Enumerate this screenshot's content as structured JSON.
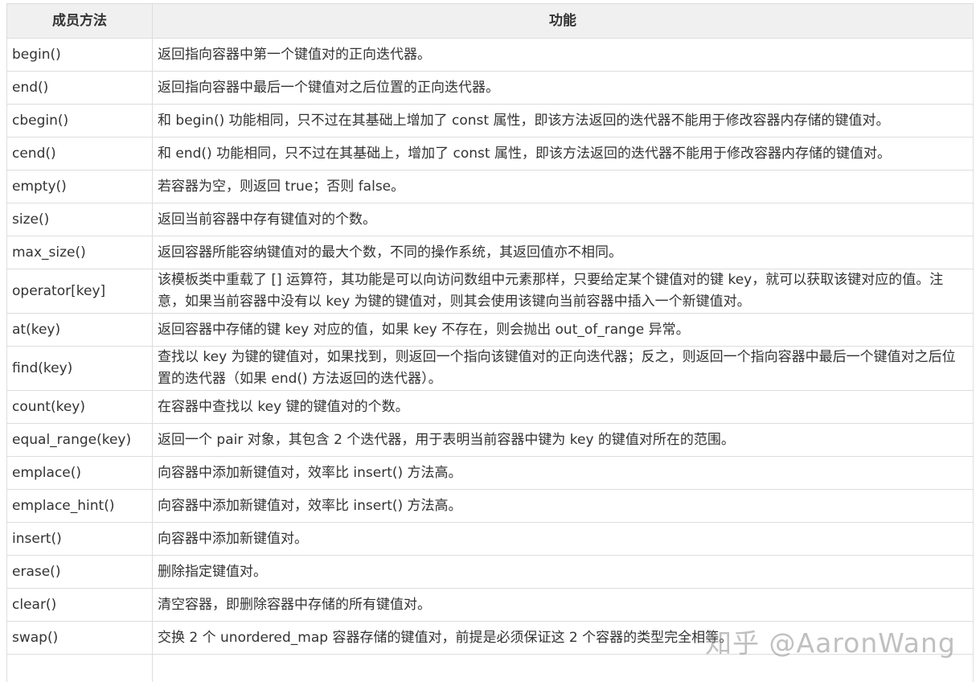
{
  "table": {
    "headers": [
      "成员方法",
      "功能"
    ],
    "rows": [
      {
        "method": "begin()",
        "desc": "返回指向容器中第一个键值对的正向迭代器。"
      },
      {
        "method": "end()",
        "desc": "返回指向容器中最后一个键值对之后位置的正向迭代器。"
      },
      {
        "method": "cbegin()",
        "desc": "和 begin() 功能相同，只不过在其基础上增加了 const 属性，即该方法返回的迭代器不能用于修改容器内存储的键值对。"
      },
      {
        "method": "cend()",
        "desc": "和 end() 功能相同，只不过在其基础上，增加了 const 属性，即该方法返回的迭代器不能用于修改容器内存储的键值对。"
      },
      {
        "method": "empty()",
        "desc": "若容器为空，则返回 true；否则 false。"
      },
      {
        "method": "size()",
        "desc": "返回当前容器中存有键值对的个数。"
      },
      {
        "method": "max_size()",
        "desc": "返回容器所能容纳键值对的最大个数，不同的操作系统，其返回值亦不相同。"
      },
      {
        "method": "operator[key]",
        "desc": "该模板类中重载了 [] 运算符，其功能是可以向访问数组中元素那样，只要给定某个键值对的键 key，就可以获取该键对应的值。注意，如果当前容器中没有以 key 为键的键值对，则其会使用该键向当前容器中插入一个新键值对。"
      },
      {
        "method": "at(key)",
        "desc": "返回容器中存储的键 key 对应的值，如果 key 不存在，则会抛出 out_of_range 异常。"
      },
      {
        "method": "find(key)",
        "desc": "查找以 key 为键的键值对，如果找到，则返回一个指向该键值对的正向迭代器；反之，则返回一个指向容器中最后一个键值对之后位置的迭代器（如果 end() 方法返回的迭代器）。"
      },
      {
        "method": "count(key)",
        "desc": "在容器中查找以 key 键的键值对的个数。"
      },
      {
        "method": "equal_range(key)",
        "desc": "返回一个 pair 对象，其包含 2 个迭代器，用于表明当前容器中键为 key 的键值对所在的范围。"
      },
      {
        "method": "emplace()",
        "desc": "向容器中添加新键值对，效率比 insert() 方法高。"
      },
      {
        "method": "emplace_hint()",
        "desc": "向容器中添加新键值对，效率比 insert() 方法高。"
      },
      {
        "method": "insert()",
        "desc": "向容器中添加新键值对。"
      },
      {
        "method": "erase()",
        "desc": "删除指定键值对。"
      },
      {
        "method": "clear()",
        "desc": "清空容器，即删除容器中存储的所有键值对。"
      },
      {
        "method": "swap()",
        "desc": "交换 2 个 unordered_map 容器存储的键值对，前提是必须保证这 2 个容器的类型完全相等。"
      }
    ]
  },
  "watermark": "知乎 @AaronWang",
  "colors": {
    "header_bg": "#f0f0f0",
    "border": "#dddddd",
    "text": "#333333"
  }
}
